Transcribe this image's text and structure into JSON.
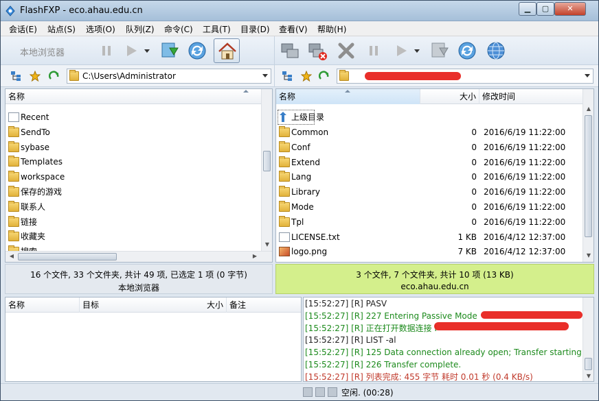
{
  "window": {
    "title": "FlashFXP - eco.ahau.edu.cn"
  },
  "menu": [
    {
      "label": "会话(E)"
    },
    {
      "label": "站点(S)"
    },
    {
      "label": "选项(O)"
    },
    {
      "label": "队列(Z)"
    },
    {
      "label": "命令(C)"
    },
    {
      "label": "工具(T)"
    },
    {
      "label": "目录(D)"
    },
    {
      "label": "查看(V)"
    },
    {
      "label": "帮助(H)"
    }
  ],
  "local": {
    "toolbar_label": "本地浏览器",
    "path": "C:\\Users\\Administrator",
    "col_name": "名称",
    "items": [
      {
        "name": "Recent",
        "icon": "special-folder-icon"
      },
      {
        "name": "SendTo",
        "icon": "folder-icon"
      },
      {
        "name": "sybase",
        "icon": "folder-icon"
      },
      {
        "name": "Templates",
        "icon": "folder-icon"
      },
      {
        "name": "workspace",
        "icon": "folder-icon"
      },
      {
        "name": "保存的游戏",
        "icon": "folder-icon"
      },
      {
        "name": "联系人",
        "icon": "folder-icon"
      },
      {
        "name": "链接",
        "icon": "folder-icon"
      },
      {
        "name": "收藏夹",
        "icon": "folder-icon"
      },
      {
        "name": "搜索",
        "icon": "folder-icon"
      }
    ],
    "status_line1": "16 个文件, 33 个文件夹, 共计 49 项, 已选定 1 项 (0 字节)",
    "status_line2": "本地浏览器"
  },
  "remote": {
    "path": "",
    "col_name": "名称",
    "col_size": "大小",
    "col_date": "修改时间",
    "parent_label": "上级目录",
    "items": [
      {
        "name": "Common",
        "size": "0",
        "date": "2016/6/19 11:22:00",
        "type": "folder"
      },
      {
        "name": "Conf",
        "size": "0",
        "date": "2016/6/19 11:22:00",
        "type": "folder"
      },
      {
        "name": "Extend",
        "size": "0",
        "date": "2016/6/19 11:22:00",
        "type": "folder"
      },
      {
        "name": "Lang",
        "size": "0",
        "date": "2016/6/19 11:22:00",
        "type": "folder"
      },
      {
        "name": "Library",
        "size": "0",
        "date": "2016/6/19 11:22:00",
        "type": "folder"
      },
      {
        "name": "Mode",
        "size": "0",
        "date": "2016/6/19 11:22:00",
        "type": "folder"
      },
      {
        "name": "Tpl",
        "size": "0",
        "date": "2016/6/19 11:22:00",
        "type": "folder"
      },
      {
        "name": "LICENSE.txt",
        "size": "1 KB",
        "date": "2016/4/12 12:37:00",
        "type": "file"
      },
      {
        "name": "logo.png",
        "size": "7 KB",
        "date": "2016/4/12 12:37:00",
        "type": "image"
      }
    ],
    "status_line1": "3 个文件, 7 个文件夹, 共计 10 项 (13 KB)",
    "status_line2": "eco.ahau.edu.cn"
  },
  "queue": {
    "col_name": "名称",
    "col_target": "目标",
    "col_size": "大小",
    "col_note": "备注"
  },
  "log": [
    {
      "text": "[15:52:27] [R] PASV",
      "color": "#222222"
    },
    {
      "text": "[15:52:27] [R] 227 Entering Passive Mode",
      "color": "#1c8a1c"
    },
    {
      "text": "[15:52:27] [R] 正在打开数据连接 I",
      "color": "#1c8a1c"
    },
    {
      "text": "[15:52:27] [R] LIST -al",
      "color": "#222222"
    },
    {
      "text": "[15:52:27] [R] 125 Data connection already open; Transfer starting.",
      "color": "#1c8a1c"
    },
    {
      "text": "[15:52:27] [R] 226 Transfer complete.",
      "color": "#1c8a1c"
    },
    {
      "text": "[15:52:27] [R] 列表完成: 455 字节 耗时 0.01 秒 (0.4 KB/s)",
      "color": "#c0392b"
    }
  ],
  "bottom": {
    "status": "空闲. (00:28)"
  }
}
